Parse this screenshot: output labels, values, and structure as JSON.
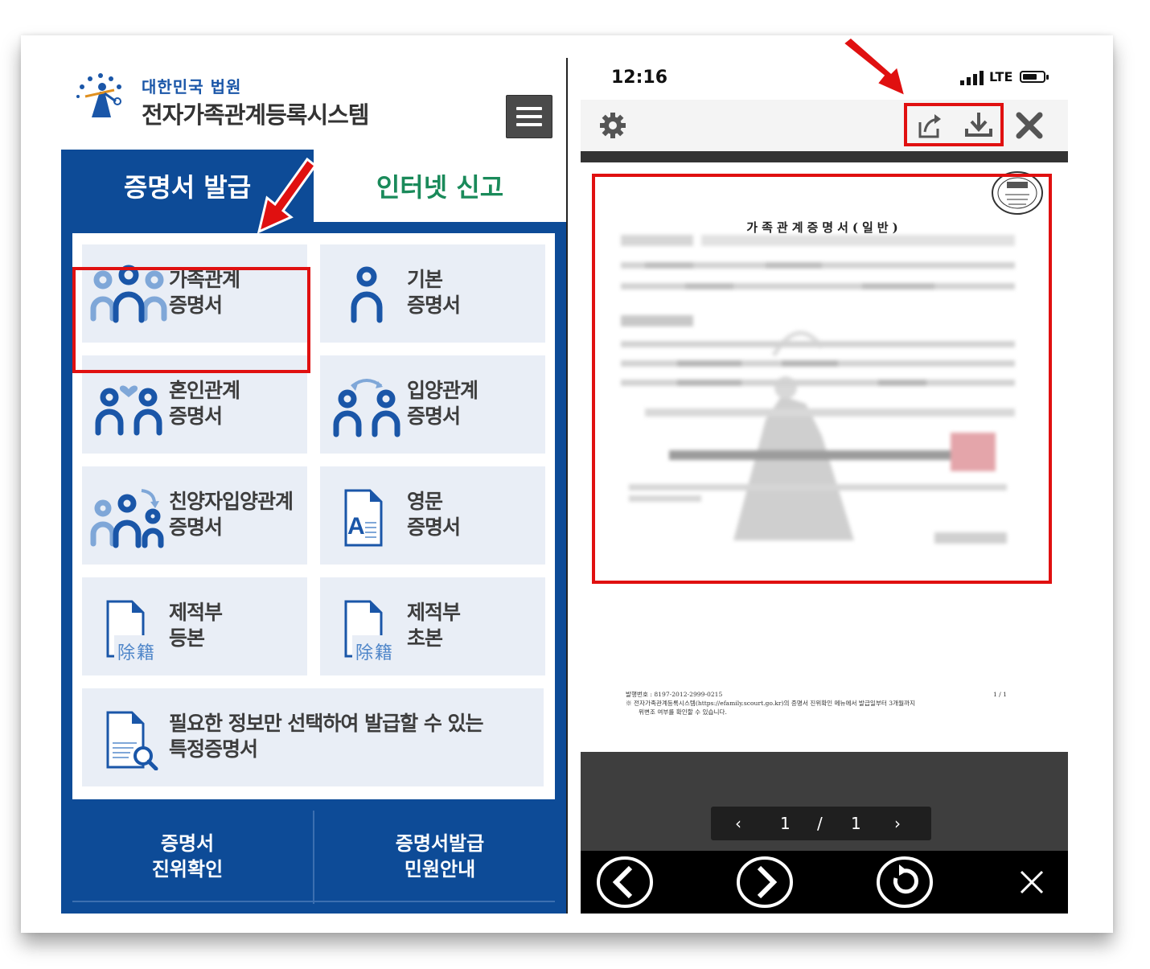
{
  "left": {
    "org_name": "대한민국 법원",
    "system_name": "전자가족관계등록시스템",
    "tabs": {
      "issue": "증명서 발급",
      "report": "인터넷 신고"
    },
    "cards": [
      {
        "line1": "가족관계",
        "line2": "증명서",
        "icon": "family-icon"
      },
      {
        "line1": "기본",
        "line2": "증명서",
        "icon": "person-icon"
      },
      {
        "line1": "혼인관계",
        "line2": "증명서",
        "icon": "marriage-icon"
      },
      {
        "line1": "입양관계",
        "line2": "증명서",
        "icon": "adoption-icon"
      },
      {
        "line1": "친양자입양관계",
        "line2": "증명서",
        "icon": "full-adoption-icon"
      },
      {
        "line1": "영문",
        "line2": "증명서",
        "icon": "english-document-icon"
      },
      {
        "line1": "제적부",
        "line2": "등본",
        "icon": "removed-register-icon",
        "mark": "除籍"
      },
      {
        "line1": "제적부",
        "line2": "초본",
        "icon": "removed-register-icon",
        "mark": "除籍"
      },
      {
        "line1": "필요한 정보만 선택하여 발급할 수 있는",
        "line2": "특정증명서",
        "icon": "document-search-icon"
      }
    ],
    "bottom": {
      "verify": {
        "line1": "증명서",
        "line2": "진위확인"
      },
      "guide": {
        "line1": "증명서발급",
        "line2": "민원안내"
      }
    }
  },
  "right": {
    "status": {
      "time": "12:16",
      "network": "LTE"
    },
    "toolbar": {
      "settings_icon": "gear-icon",
      "share_icon": "share-icon",
      "download_icon": "download-icon",
      "close_icon": "close-icon"
    },
    "document": {
      "title": "가족관계증명서(일반)",
      "footer_line1": "발행번호 : 8197-2012-2999-0215",
      "footer_page": "1 / 1",
      "footer_line2": "※ 전자가족관계등록시스템(https://efamily.scourt.go.kr)의 증명서 진위확인 메뉴에서 발급일부터 3개월까지",
      "footer_line3": "위변조 여부를 확인할 수 있습니다."
    },
    "pager": {
      "current": "1",
      "separator": "/",
      "total": "1"
    }
  },
  "colors": {
    "court_blue": "#0d4b97",
    "report_green": "#1a8a5a",
    "highlight_red": "#e01010"
  }
}
